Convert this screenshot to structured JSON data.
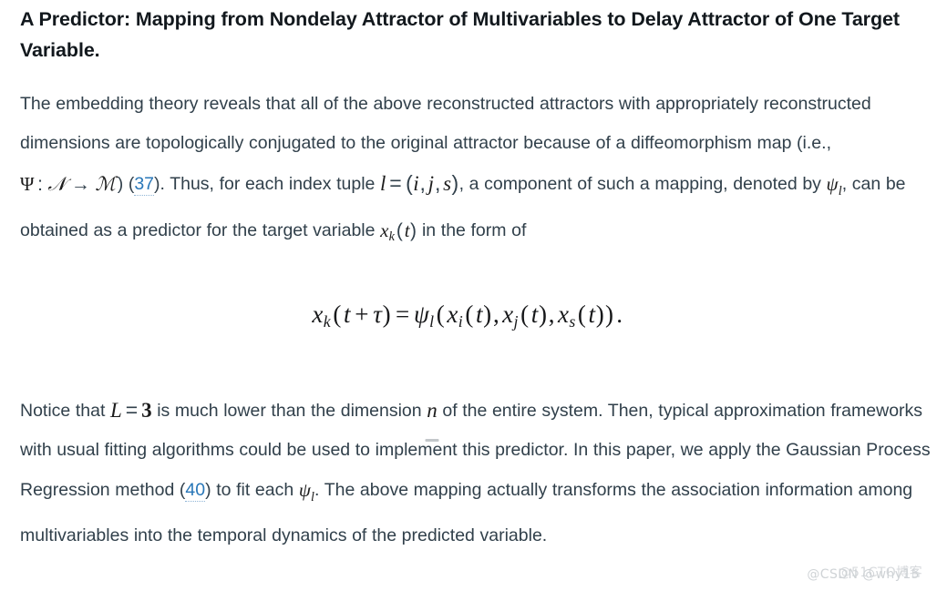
{
  "document": {
    "title": "A Predictor: Mapping from Nondelay Attractor of Multivariables to Delay Attractor of One Target Variable.",
    "background_color": "#ffffff",
    "text_color": "#31404b",
    "link_color": "#2977b8"
  },
  "paragraph_1": {
    "seg_1": "The embedding theory reveals that all of the above reconstructed attractors with appropriately reconstructed dimensions are topologically conjugated to the original attractor because of a diffeomorphism map (i.e., ",
    "math_psi": "Ψ",
    "math_colon": ":",
    "math_scriptN": "𝒩",
    "math_arrow": "→",
    "math_scriptM": "ℳ",
    "seg_2": ") ",
    "cite_37_open": "(",
    "cite_37": "37",
    "cite_37_close": ")",
    "seg_3": ". Thus, for each index tuple ",
    "math_l": "l",
    "math_eq": "=",
    "math_tuple_open": "(",
    "math_i": "i",
    "math_comma_1": ",",
    "math_j": "j",
    "math_comma_2": ",",
    "math_s": "s",
    "math_tuple_close": ")",
    "seg_4": ", a component of such a mapping, denoted by ",
    "math_psi_l_base": "ψ",
    "math_psi_l_sub": "l",
    "seg_5": ", can be obtained as a predictor for the target variable ",
    "math_x_base": "x",
    "math_x_sub": "k",
    "math_t_open": "(",
    "math_t": "t",
    "math_t_close": ")",
    "seg_6": " in the form of"
  },
  "equation": {
    "lhs_x": "x",
    "lhs_sub": "k",
    "lhs_open": "(",
    "lhs_t": "t",
    "lhs_plus": "+",
    "lhs_tau": "τ",
    "lhs_close": ")",
    "equals": "=",
    "psi": "ψ",
    "psi_sub": "l",
    "arg_open": "(",
    "a1_x": "x",
    "a1_sub": "i",
    "a1_open": "(",
    "a1_t": "t",
    "a1_close": ")",
    "c1": ",",
    "a2_x": "x",
    "a2_sub": "j",
    "a2_open": "(",
    "a2_t": "t",
    "a2_close": ")",
    "c2": ",",
    "a3_x": "x",
    "a3_sub": "s",
    "a3_open": "(",
    "a3_t": "t",
    "a3_close": ")",
    "arg_close": ")",
    "period": ".",
    "plain_text": "x_k (t + τ) = ψ_l (x_i (t), x_j (t), x_s (t))."
  },
  "paragraph_2": {
    "seg_1": "Notice that ",
    "math_L": "L",
    "math_eq": "=",
    "math_3": "3",
    "seg_2": " is much lower than the dimension ",
    "math_n": "n",
    "seg_3": " of the entire system. Then, typical approximation frameworks with usual fitting algorithms could be used to implement this predictor. In this paper, we apply the Gaussian Process Regression method ",
    "cite_40_open": "(",
    "cite_40": "40",
    "cite_40_close": ")",
    "seg_4": " to fit each ",
    "math_psi_base": "ψ",
    "math_psi_sub": "l",
    "seg_5": ". The above mapping actually transforms the association information among multivariables into the temporal dynamics of the predicted variable."
  },
  "watermarks": {
    "primary": "@51CTO博客",
    "secondary": "@CSDN @why15"
  }
}
